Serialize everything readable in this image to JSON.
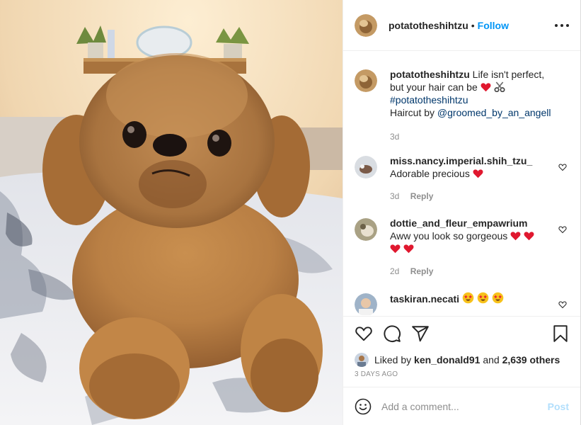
{
  "post": {
    "author": "potatotheshihtzu",
    "dot": "•",
    "follow_label": "Follow",
    "image_alt": "Shih Tzu dog lying on a bed"
  },
  "caption": {
    "username": "potatotheshihtzu",
    "text": "Life isn't perfect, but your hair can be",
    "hashtag": "#potatotheshihtzu",
    "credit_prefix": "Haircut by",
    "credit_mention": "@groomed_by_an_angell",
    "time": "3d"
  },
  "comments": [
    {
      "username": "miss.nancy.imperial.shih_tzu_",
      "text": "Adorable precious",
      "time": "3d",
      "reply_label": "Reply"
    },
    {
      "username": "dottie_and_fleur_empawrium",
      "text": "Aww you look so gorgeous",
      "time": "2d",
      "reply_label": "Reply"
    },
    {
      "username": "taskiran.necati",
      "text": ""
    }
  ],
  "likes": {
    "prefix": "Liked by",
    "user": "ken_donald91",
    "connector": "and",
    "count": "2,639 others"
  },
  "timestamp": "3 DAYS AGO",
  "add_comment": {
    "placeholder": "Add a comment...",
    "post_label": "Post"
  },
  "colors": {
    "accent": "#0095f6",
    "link": "#00376b",
    "muted": "#8e8e8e",
    "heart": "#ed4956",
    "post_disabled": "#b2dffc"
  },
  "icons": [
    "more-options-icon",
    "heart-icon",
    "comment-icon",
    "share-icon",
    "bookmark-icon",
    "emoji-icon",
    "red-heart-emoji",
    "scissors-emoji",
    "star-eyes-emoji"
  ]
}
